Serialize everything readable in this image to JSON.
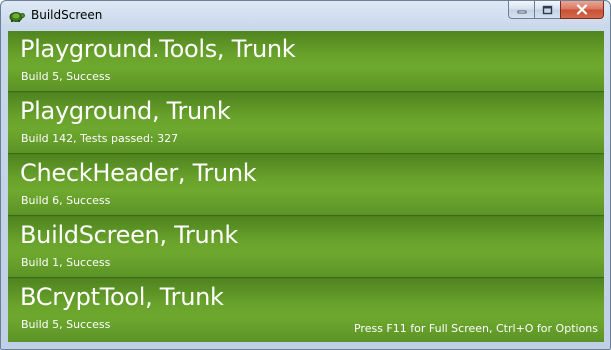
{
  "window": {
    "title": "BuildScreen",
    "app_icon": "turtle-icon",
    "controls": {
      "minimize_icon": "minimize-icon",
      "maximize_icon": "maximize-icon",
      "close_icon": "close-icon"
    }
  },
  "builds": [
    {
      "name": "Playground.Tools, Trunk",
      "status": "Build 5, Success",
      "state": "success"
    },
    {
      "name": "Playground, Trunk",
      "status": "Build 142, Tests passed: 327",
      "state": "success"
    },
    {
      "name": "CheckHeader, Trunk",
      "status": "Build 6, Success",
      "state": "success"
    },
    {
      "name": "BuildScreen, Trunk",
      "status": "Build 1, Success",
      "state": "success"
    },
    {
      "name": "BCryptTool, Trunk",
      "status": "Build 5, Success",
      "state": "success"
    }
  ],
  "hint": "Press F11 for Full Screen, Ctrl+O for Options",
  "colors": {
    "success_tile": "#69a22b",
    "success_tile_dark": "#4f841f",
    "text": "#ffffff"
  }
}
